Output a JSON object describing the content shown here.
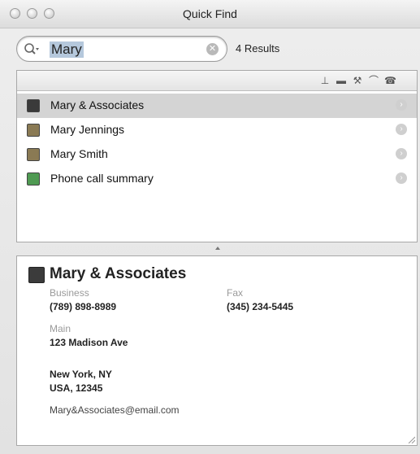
{
  "window": {
    "title": "Quick Find"
  },
  "search": {
    "value": "Mary",
    "results_count": "4 Results"
  },
  "results": [
    {
      "label": "Mary & Associates",
      "icon": "business-icon",
      "selected": true
    },
    {
      "label": "Mary Jennings",
      "icon": "person-icon",
      "selected": false
    },
    {
      "label": "Mary Smith",
      "icon": "person-icon",
      "selected": false
    },
    {
      "label": "Phone call summary",
      "icon": "phone-note-icon",
      "selected": false
    }
  ],
  "detail": {
    "name": "Mary & Associates",
    "business_label": "Business",
    "business_value": "(789) 898-8989",
    "fax_label": "Fax",
    "fax_value": "(345) 234-5445",
    "main_label": "Main",
    "address_line1": "123 Madison Ave",
    "address_line2": "New York, NY",
    "address_line3": "USA, 12345",
    "email": "Mary&Associates@email.com"
  }
}
